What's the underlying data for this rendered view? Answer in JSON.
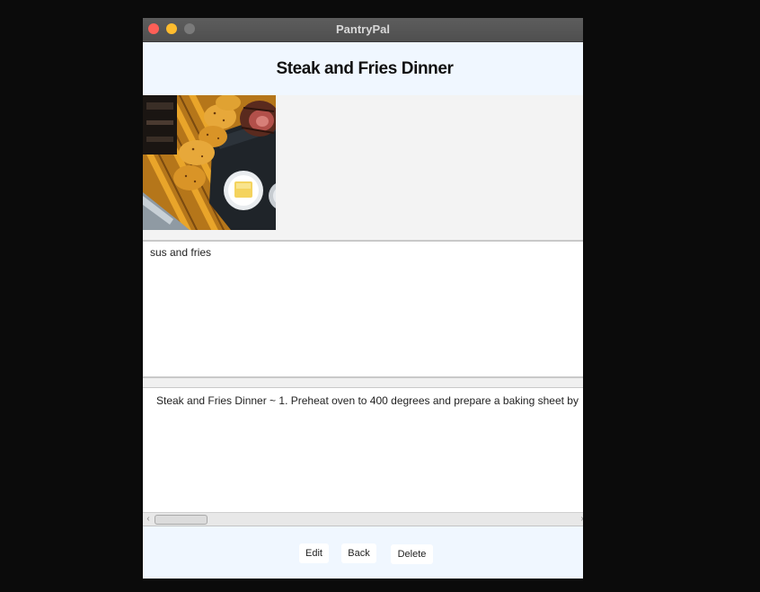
{
  "window": {
    "title": "PantryPal"
  },
  "recipe": {
    "title": "Steak and Fries Dinner",
    "description": "sus and fries",
    "instructions": "Steak and Fries Dinner ~  1. Preheat oven to 400 degrees and prepare a baking sheet by"
  },
  "image": {
    "subject": "steak-and-fries-photo"
  },
  "buttons": {
    "edit_label": "Edit",
    "back_label": "Back",
    "delete_label": "Delete"
  },
  "colors": {
    "panel_background": "#f0f7ff",
    "titlebar": "#555555",
    "close": "#fe5f57",
    "minimize": "#febc2e"
  }
}
